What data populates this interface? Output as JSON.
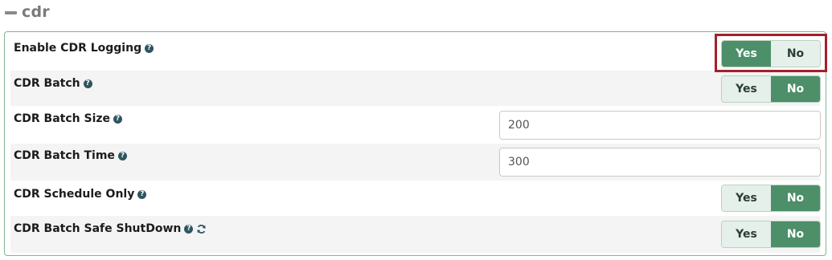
{
  "section": {
    "title": "cdr",
    "collapse_icon": "minus-icon"
  },
  "rows": [
    {
      "label": "Enable CDR Logging",
      "type": "toggle",
      "yes": "Yes",
      "no": "No",
      "value": "Yes"
    },
    {
      "label": "CDR Batch",
      "type": "toggle",
      "yes": "Yes",
      "no": "No",
      "value": "No"
    },
    {
      "label": "CDR Batch Size",
      "type": "input",
      "value": "200"
    },
    {
      "label": "CDR Batch Time",
      "type": "input",
      "value": "300"
    },
    {
      "label": "CDR Schedule Only",
      "type": "toggle",
      "yes": "Yes",
      "no": "No",
      "value": "No"
    },
    {
      "label": "CDR Batch Safe ShutDown",
      "type": "toggle",
      "yes": "Yes",
      "no": "No",
      "value": "No",
      "extra_icon": "refresh-icon"
    }
  ],
  "colors": {
    "active": "#4c8f68",
    "inactive": "#e5f0ea",
    "highlight": "#a3202a",
    "panel_border": "#7fb58f"
  }
}
